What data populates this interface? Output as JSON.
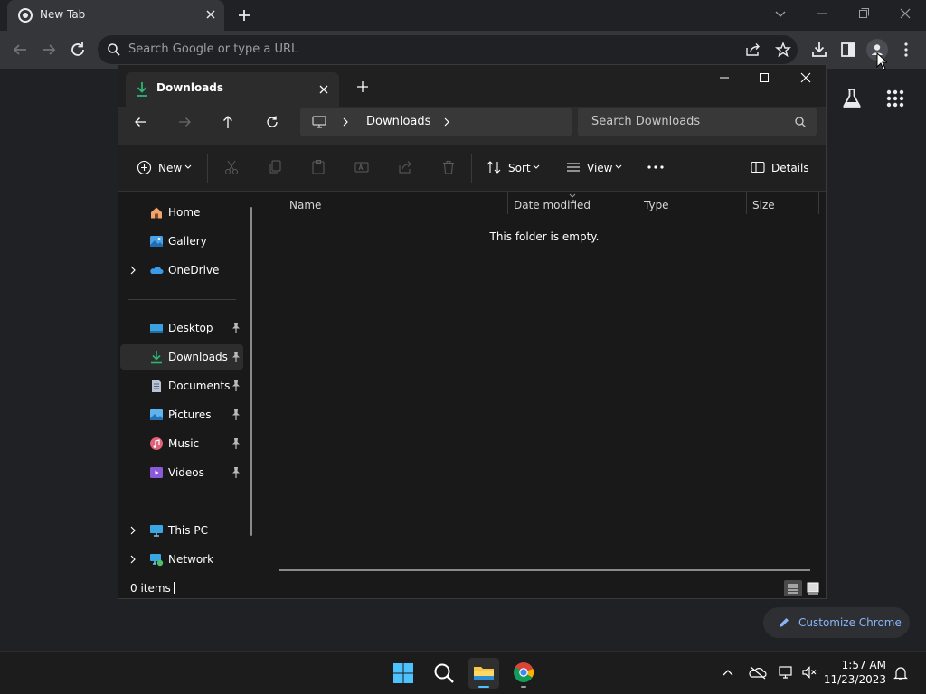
{
  "browser": {
    "tab_title": "New Tab",
    "omnibox_placeholder": "Search Google or type a URL",
    "customize_label": "Customize Chrome"
  },
  "explorer": {
    "tab_title": "Downloads",
    "breadcrumb": [
      "Downloads"
    ],
    "search_placeholder": "Search Downloads",
    "commands": {
      "new": "New",
      "sort": "Sort",
      "view": "View",
      "details": "Details"
    },
    "sidebar": {
      "top": [
        {
          "label": "Home",
          "icon": "home-icon"
        },
        {
          "label": "Gallery",
          "icon": "gallery-icon"
        },
        {
          "label": "OneDrive",
          "icon": "onedrive-icon",
          "expandable": true
        }
      ],
      "quick_access": [
        {
          "label": "Desktop",
          "icon": "desktop-folder-icon",
          "pinned": true
        },
        {
          "label": "Downloads",
          "icon": "downloads-folder-icon",
          "pinned": true,
          "selected": true
        },
        {
          "label": "Documents",
          "icon": "documents-folder-icon",
          "pinned": true
        },
        {
          "label": "Pictures",
          "icon": "pictures-folder-icon",
          "pinned": true
        },
        {
          "label": "Music",
          "icon": "music-folder-icon",
          "pinned": true
        },
        {
          "label": "Videos",
          "icon": "videos-folder-icon",
          "pinned": true
        }
      ],
      "bottom": [
        {
          "label": "This PC",
          "icon": "this-pc-icon",
          "expandable": true
        },
        {
          "label": "Network",
          "icon": "network-icon",
          "expandable": true
        }
      ]
    },
    "columns": [
      "Name",
      "Date modified",
      "Type",
      "Size"
    ],
    "empty_message": "This folder is empty.",
    "status": "0 items"
  },
  "taskbar": {
    "time": "1:57 AM",
    "date": "11/23/2023"
  },
  "colors": {
    "accent": "#0078d4",
    "chrome_link": "#8ab4f8",
    "download_green": "#2bb673"
  }
}
